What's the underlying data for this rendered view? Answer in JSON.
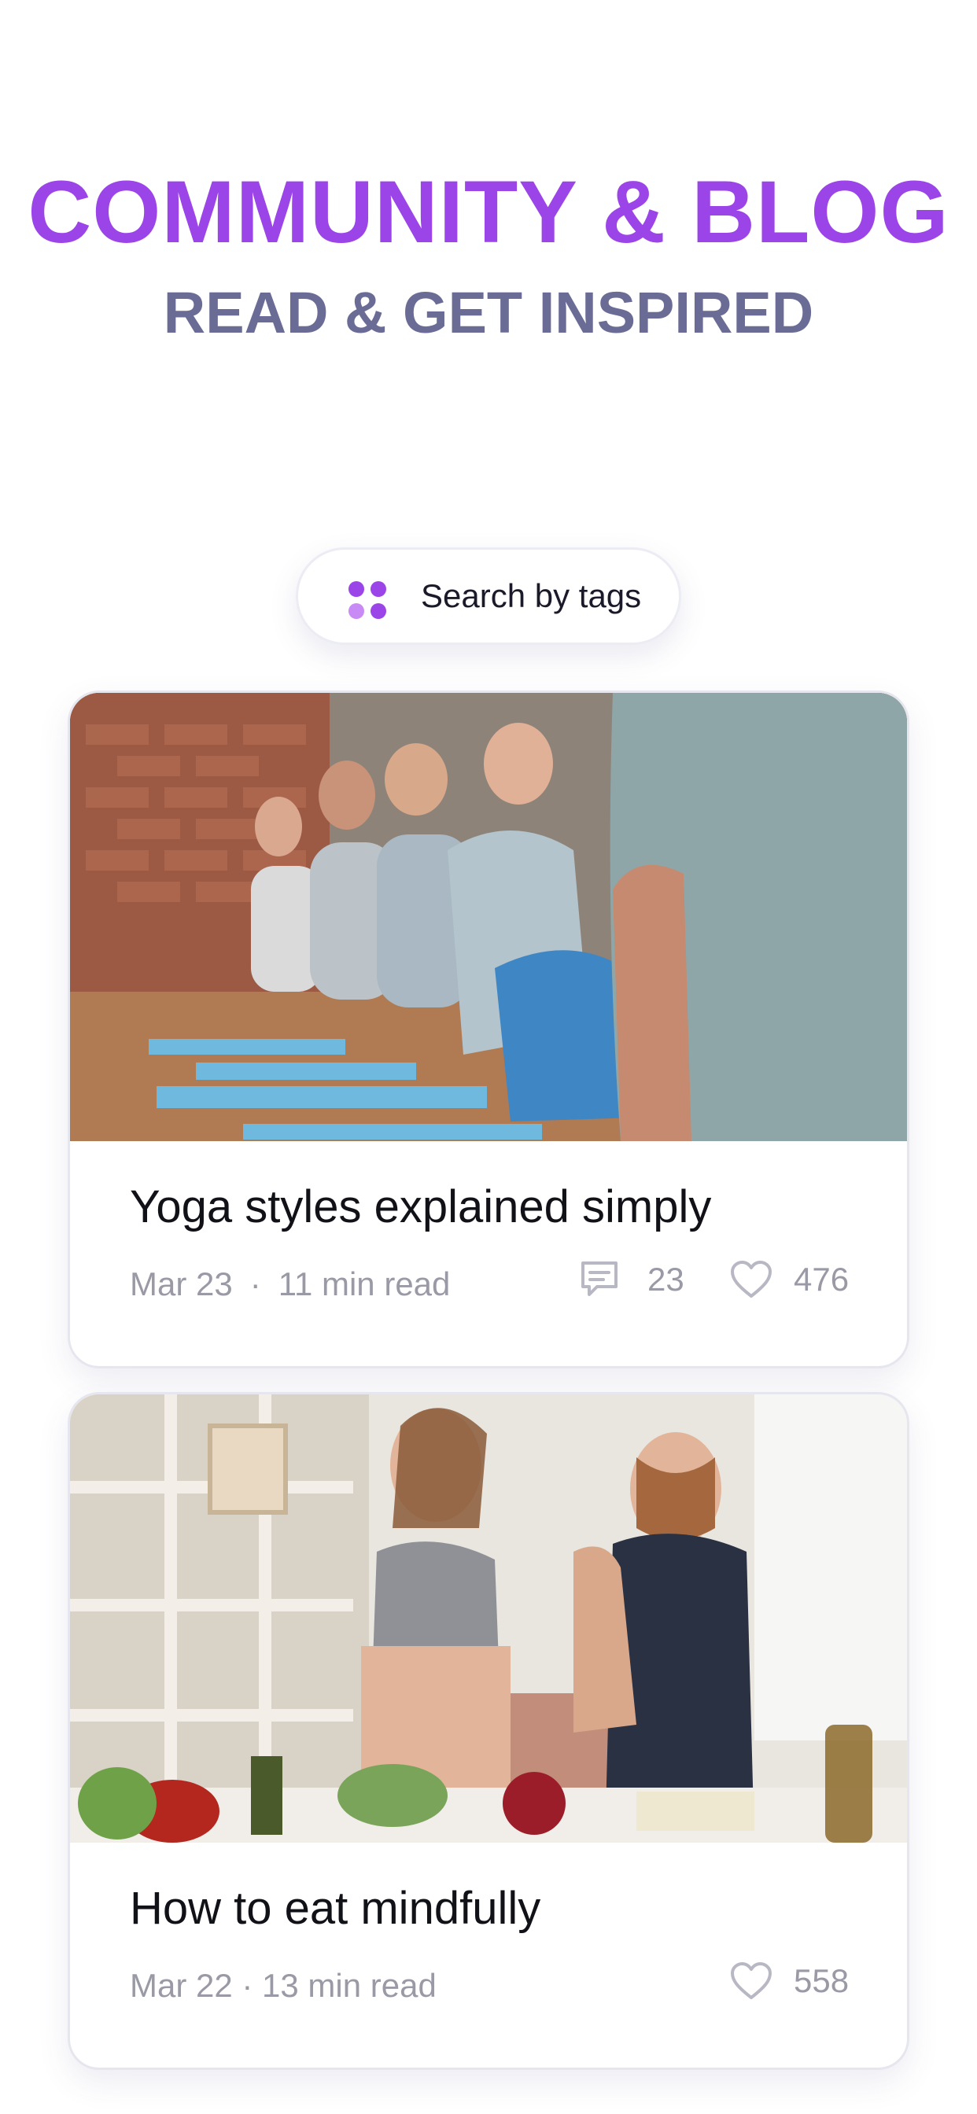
{
  "header": {
    "title": "COMMUNITY & BLOG",
    "subtitle": "READ & GET INSPIRED"
  },
  "search": {
    "label": "Search by tags",
    "icon": "tags-grid-icon"
  },
  "colors": {
    "accent": "#9B44E8",
    "subtitle": "#6A6C95",
    "dots": [
      "#9B44E8",
      "#B36BF0",
      "#C88BF5",
      "#9B44E8"
    ]
  },
  "posts": [
    {
      "title": "Yoga styles explained simply",
      "date": "Mar 23",
      "separator": "·",
      "read_time": "11 min read",
      "comments": "23",
      "likes": "476",
      "image": "yoga-class-photo"
    },
    {
      "title": "How to eat mindfully",
      "meta": "Mar 22 · 13 min read",
      "likes": "558",
      "image": "couple-cooking-photo"
    }
  ]
}
